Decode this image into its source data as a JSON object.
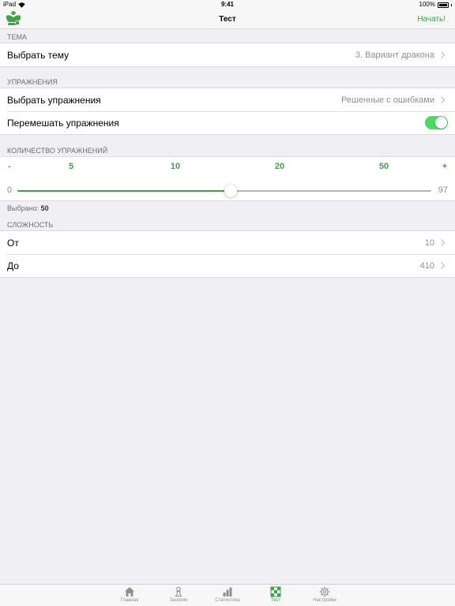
{
  "status_bar": {
    "device": "iPad",
    "time": "9:41",
    "battery": "100%"
  },
  "nav": {
    "title": "Тест",
    "start_label": "Начать!"
  },
  "theme": {
    "header": "ТЕМА",
    "choose_label": "Выбрать тему",
    "choose_value": "3. Вариант дракона"
  },
  "exercises": {
    "header": "УПРАЖНЕНИЯ",
    "choose_label": "Выбрать упражнения",
    "choose_value": "Решенные с ошибками",
    "shuffle_label": "Перемешать упражнения",
    "shuffle_on": true
  },
  "count": {
    "header": "КОЛИЧЕСТВО УПРАЖНЕНИЙ",
    "decrease": "-",
    "presets": [
      "5",
      "10",
      "20",
      "50"
    ],
    "increase": "+",
    "min": 0,
    "max": 97,
    "value": 50,
    "selected_label": "Выбрано:",
    "selected_value": "50"
  },
  "difficulty": {
    "header": "СЛОЖНОСТЬ",
    "from_label": "От",
    "from_value": "10",
    "to_label": "До",
    "to_value": "410"
  },
  "tabs": [
    {
      "label": "Главная",
      "icon": "home-icon",
      "active": false
    },
    {
      "label": "Занятия",
      "icon": "pawn-icon",
      "active": false
    },
    {
      "label": "Статистика",
      "icon": "bar-chart-icon",
      "active": false
    },
    {
      "label": "Тест",
      "icon": "checkerboard-icon",
      "active": true
    },
    {
      "label": "Настройки",
      "icon": "gear-icon",
      "active": false
    }
  ],
  "colors": {
    "accent": "#3fa149",
    "toggle_on": "#4cd964",
    "background": "#efeff4",
    "secondary_text": "#8e8e93"
  }
}
